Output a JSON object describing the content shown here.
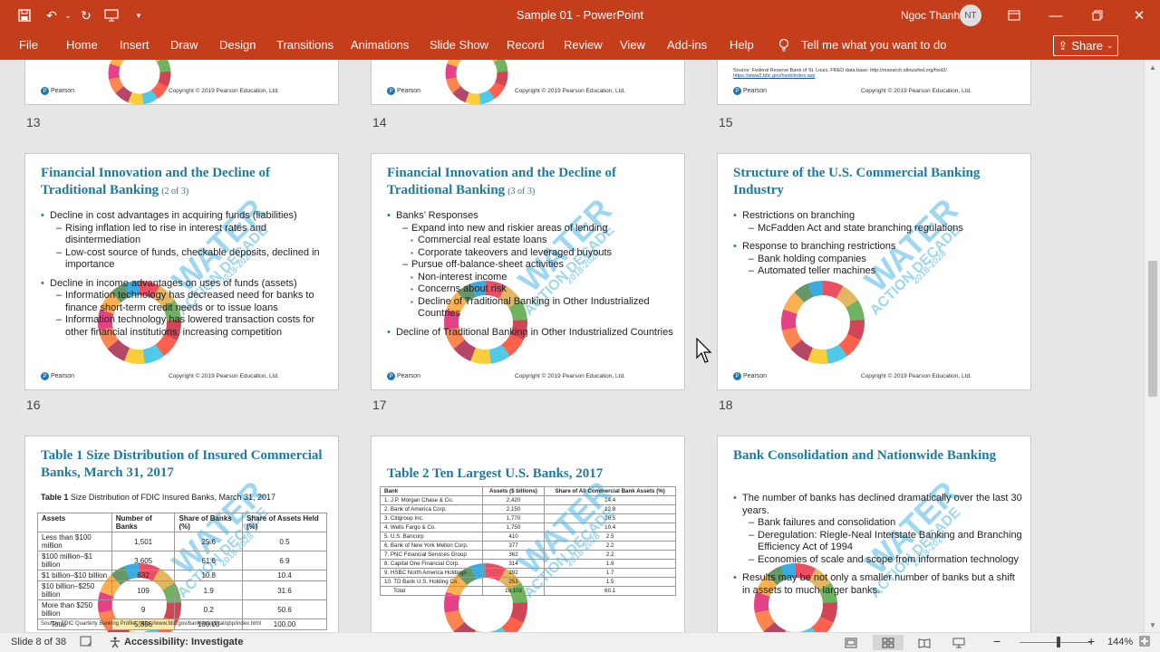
{
  "app": {
    "doc_title": "Sample 01  -  PowerPoint",
    "user_name": "Ngoc Thanh",
    "user_initials": "NT",
    "accent": "#c43e1c"
  },
  "ribbon": {
    "tabs": [
      "File",
      "Home",
      "Insert",
      "Draw",
      "Design",
      "Transitions",
      "Animations",
      "Slide Show",
      "Record",
      "Review",
      "View",
      "Add-ins",
      "Help"
    ],
    "tell_me": "Tell me what you want to do",
    "share": "Share"
  },
  "top_row": {
    "numbers": [
      "13",
      "14",
      "15"
    ],
    "copyright": "Copyright © 2019 Pearson Education, Ltd.",
    "pearson": "Pearson",
    "source_15": "Source: Federal Reserve Bank of St. Louis, FRED data base: http://research.stlouisfed.org/fred2/",
    "source_15b": "https://www2.fdic.gov/hsob/index.asp"
  },
  "slides": {
    "s16": {
      "number": "16",
      "title": "Financial Innovation and the Decline of Traditional Banking",
      "subtitle": "(2 of 3)",
      "bullets": [
        {
          "level": 1,
          "text": "Decline in cost advantages in acquiring funds (liabilities)"
        },
        {
          "level": 2,
          "text": "Rising inflation led to rise in interest rates and disintermediation"
        },
        {
          "level": 2,
          "text": "Low-cost source of funds, checkable deposits, declined in importance"
        },
        {
          "level": 1,
          "text": "Decline in income advantages on uses of funds (assets)"
        },
        {
          "level": 2,
          "text": "Information technology has decreased need for banks to finance short-term credit needs or to issue loans"
        },
        {
          "level": 2,
          "text": "Information technology has lowered transaction costs for other financial institutions, increasing competition"
        }
      ]
    },
    "s17": {
      "number": "17",
      "title": "Financial Innovation and the Decline of Traditional Banking",
      "subtitle": "(3 of 3)",
      "bullets": [
        {
          "level": 1,
          "text": "Banks’ Responses"
        },
        {
          "level": 2,
          "text": "Expand into new and riskier areas of lending"
        },
        {
          "level": 3,
          "text": "Commercial real estate loans"
        },
        {
          "level": 3,
          "text": "Corporate takeovers and leveraged buyouts"
        },
        {
          "level": 2,
          "text": "Pursue off-balance-sheet activities"
        },
        {
          "level": 3,
          "text": "Non-interest income"
        },
        {
          "level": 3,
          "text": "Concerns about risk"
        },
        {
          "level": 3,
          "text": "Decline of Traditional Banking in Other Industrialized Countries"
        },
        {
          "level": 1,
          "text": "Decline of Traditional Banking in Other Industrialized Countries"
        }
      ]
    },
    "s18": {
      "number": "18",
      "title": "Structure of the U.S. Commercial Banking Industry",
      "bullets": [
        {
          "level": 1,
          "text": "Restrictions on branching"
        },
        {
          "level": 2,
          "text": "McFadden Act and state branching regulations"
        },
        {
          "level": 1,
          "text": "Response to branching restrictions"
        },
        {
          "level": 2,
          "text": "Bank holding companies"
        },
        {
          "level": 2,
          "text": "Automated teller machines"
        }
      ]
    },
    "s19": {
      "title": "Table 1 Size Distribution of Insured Commercial Banks, March 31, 2017",
      "caption_bold": "Table 1",
      "caption": "Size Distribution of FDIC Insured Banks, March 31, 2017",
      "headers": [
        "Assets",
        "Number of Banks",
        "Share of Banks (%)",
        "Share of Assets Held (%)"
      ],
      "rows": [
        [
          "Less than $100 million",
          "1,501",
          "25.6",
          "0.5"
        ],
        [
          "$100 million–$1 billion",
          "3,605",
          "61.6",
          "6.9"
        ],
        [
          "$1 billion–$10 billion",
          "632",
          "10.8",
          "10.4"
        ],
        [
          "$10 billion–$250 billion",
          "109",
          "1.9",
          "31.6"
        ],
        [
          "More than $250 billion",
          "9",
          "0.2",
          "50.6"
        ],
        [
          "Total",
          "5,856",
          "100.00",
          "100.00"
        ]
      ],
      "source": "Source: FDIC Quarterly Banking Profile, https://www.fdic.gov/bank/analytical/qbp/index.html"
    },
    "s20": {
      "title": "Table 2 Ten Largest U.S. Banks, 2017",
      "headers": [
        "Bank",
        "Assets ($ billions)",
        "Share of All Commercial Bank Assets (%)"
      ],
      "rows": [
        [
          "1. J.P. Morgan Chase & Co.",
          "2,420",
          "14.4"
        ],
        [
          "2. Bank of America Corp.",
          "2,150",
          "12.8"
        ],
        [
          "3. Citigroup Inc.",
          "1,770",
          "10.5"
        ],
        [
          "4. Wells Fargo & Co.",
          "1,750",
          "10.4"
        ],
        [
          "5. U.S. Bancorp",
          "410",
          "2.5"
        ],
        [
          "6. Bank of New York Mellon Corp.",
          "377",
          "2.2"
        ],
        [
          "7. PNC Financial Services Group",
          "362",
          "2.2"
        ],
        [
          "8. Capital One Financial Corp.",
          "314",
          "1.9"
        ],
        [
          "9. HSBC North America Holdings",
          "292",
          "1.7"
        ],
        [
          "10. TD Bank U.S. Holding Co.",
          "253",
          "1.5"
        ],
        [
          "Total",
          "10,103",
          "60.1"
        ]
      ]
    },
    "s21": {
      "title": "Bank Consolidation and Nationwide Banking",
      "bullets": [
        {
          "level": 1,
          "text": "The number of banks has declined dramatically over the last 30 years."
        },
        {
          "level": 2,
          "text": "Bank failures and consolidation"
        },
        {
          "level": 2,
          "text": "Deregulation: Riegle-Neal Interstate Banking and Branching Efficiency Act of 1994"
        },
        {
          "level": 2,
          "text": "Economies of scale and scope from information technology"
        },
        {
          "level": 1,
          "text": "Results may be not only a smaller number of banks but a shift in assets to much larger banks."
        }
      ]
    }
  },
  "watermark": {
    "line1": "WATER",
    "line2": "ACTION DECADE",
    "line3": "2018-2028"
  },
  "status": {
    "slide_of": "Slide 8 of 38",
    "accessibility": "Accessibility: Investigate",
    "zoom": "144%"
  }
}
